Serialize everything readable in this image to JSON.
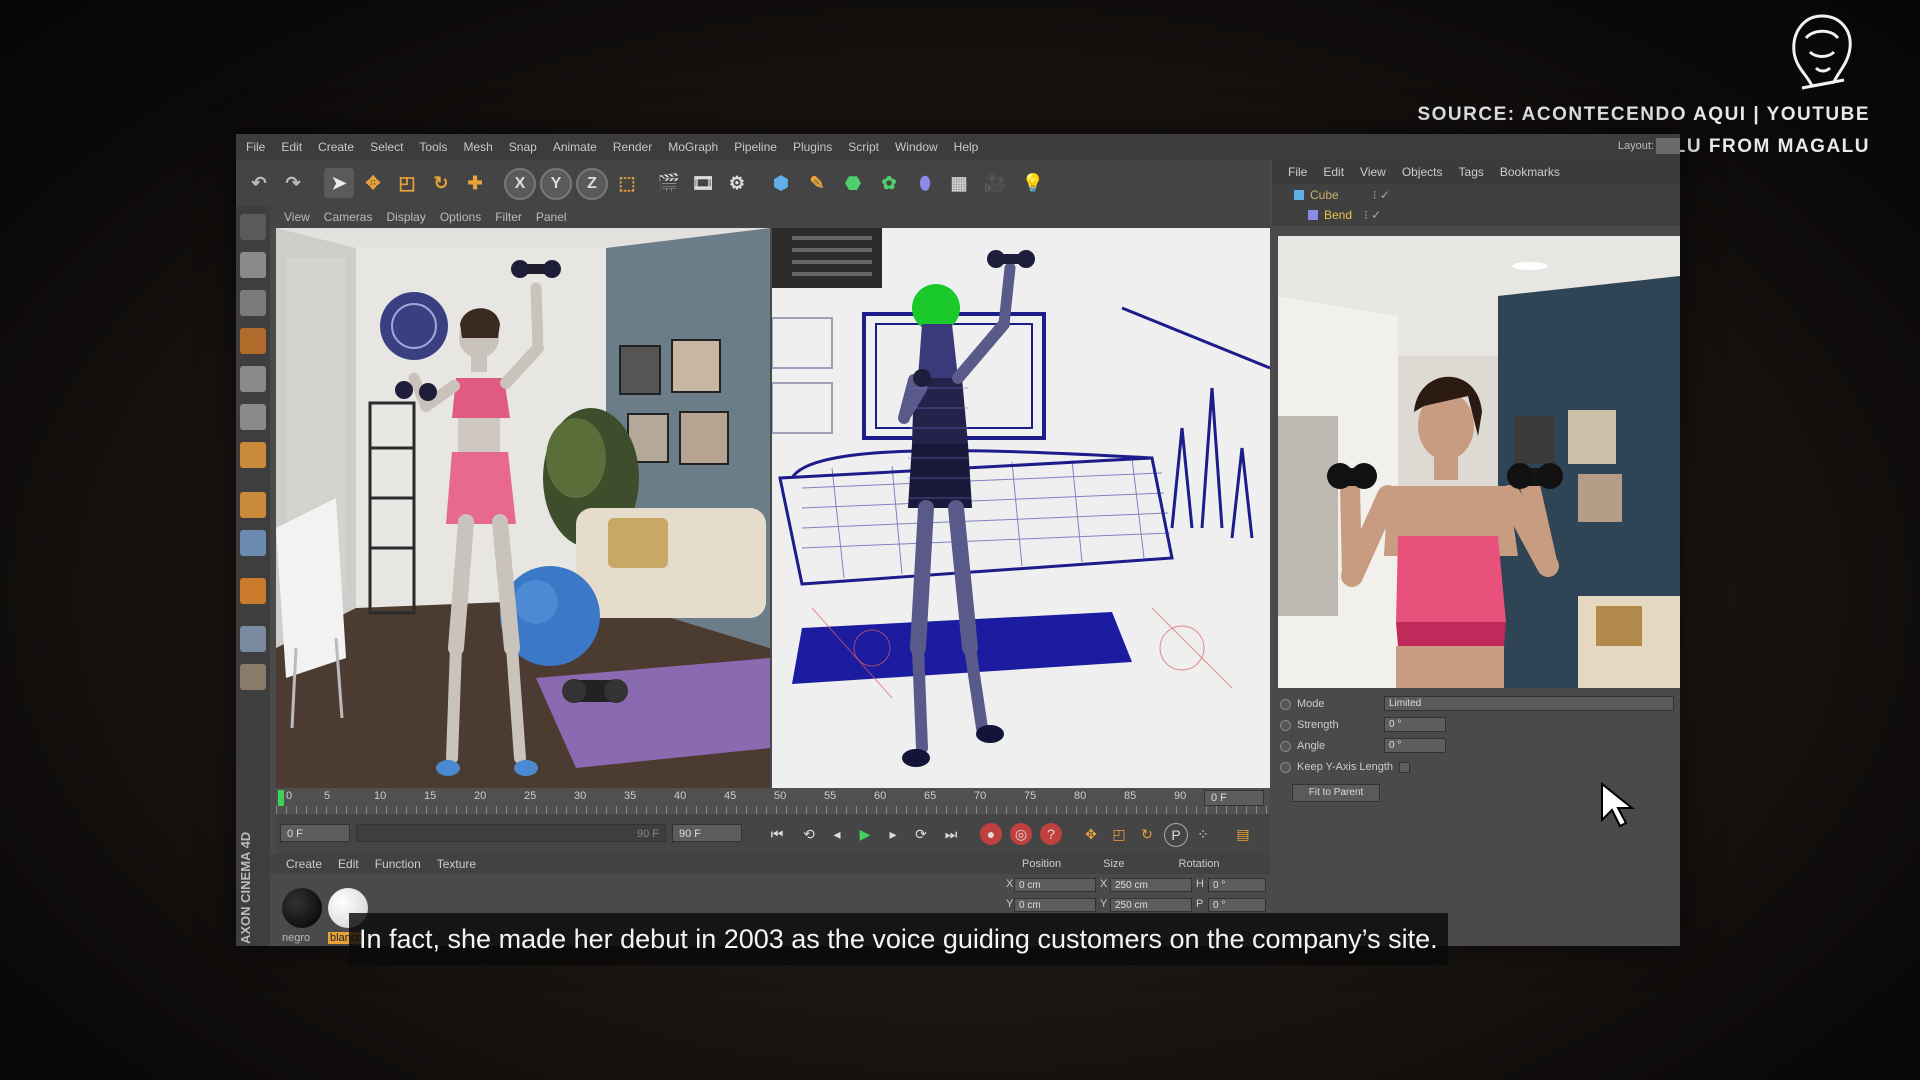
{
  "source": {
    "line1": "SOURCE: ACONTECENDO AQUI | YOUTUBE",
    "line2": "LU FROM MAGALU"
  },
  "watermark_icon": "lion-head-icon",
  "app": {
    "menu": [
      "File",
      "Edit",
      "Create",
      "Select",
      "Tools",
      "Mesh",
      "Snap",
      "Animate",
      "Render",
      "MoGraph",
      "Pipeline",
      "Plugins",
      "Script",
      "Window",
      "Help"
    ],
    "layout_label": "Layout:",
    "viewport_menu": [
      "View",
      "Cameras",
      "Display",
      "Options",
      "Filter",
      "Panel"
    ],
    "object_manager": {
      "menu": [
        "File",
        "Edit",
        "View",
        "Objects",
        "Tags",
        "Bookmarks"
      ],
      "objects": [
        {
          "name": "Cube",
          "color": "#c8b06a"
        },
        {
          "name": "Bend",
          "color": "#e6c34a"
        }
      ]
    },
    "timeline": {
      "frames": [
        "0",
        "5",
        "10",
        "15",
        "20",
        "25",
        "30",
        "35",
        "40",
        "45",
        "50",
        "55",
        "60",
        "65",
        "70",
        "75",
        "80",
        "85",
        "90"
      ],
      "current_frame": "0 F",
      "start_field": "0 F",
      "end_field": "90 F",
      "range_end": "90 F"
    },
    "material_manager": {
      "menu": [
        "Create",
        "Edit",
        "Function",
        "Texture"
      ],
      "materials": [
        {
          "name": "negro",
          "color": "#000000"
        },
        {
          "name": "blanco",
          "color": "#ffffff"
        }
      ]
    },
    "coordinates": {
      "headers": [
        "Position",
        "Size",
        "Rotation"
      ],
      "rows": [
        {
          "axis": "X",
          "position": "0 cm",
          "size_axis": "X",
          "size": "250 cm",
          "rot_axis": "H",
          "rotation": "0 °"
        },
        {
          "axis": "Y",
          "position": "0 cm",
          "size_axis": "Y",
          "size": "250 cm",
          "rot_axis": "P",
          "rotation": "0 °"
        }
      ]
    },
    "attributes": {
      "mode_label": "Mode",
      "mode_value": "Limited",
      "strength_label": "Strength",
      "strength_value": "0 °",
      "angle_label": "Angle",
      "angle_value": "0 °",
      "keep_label": "Keep Y-Axis Length",
      "fit_button": "Fit to Parent"
    },
    "brand": "AXON CINEMA 4D"
  },
  "subtitle": "In fact, she made her debut in 2003 as the voice guiding customers on the company’s site.",
  "colors": {
    "accent_orange": "#e8a23a",
    "wire_blue": "#1c1c8a",
    "outfit_pink": "#e9517d",
    "wall_teal": "#5d6f7a"
  }
}
